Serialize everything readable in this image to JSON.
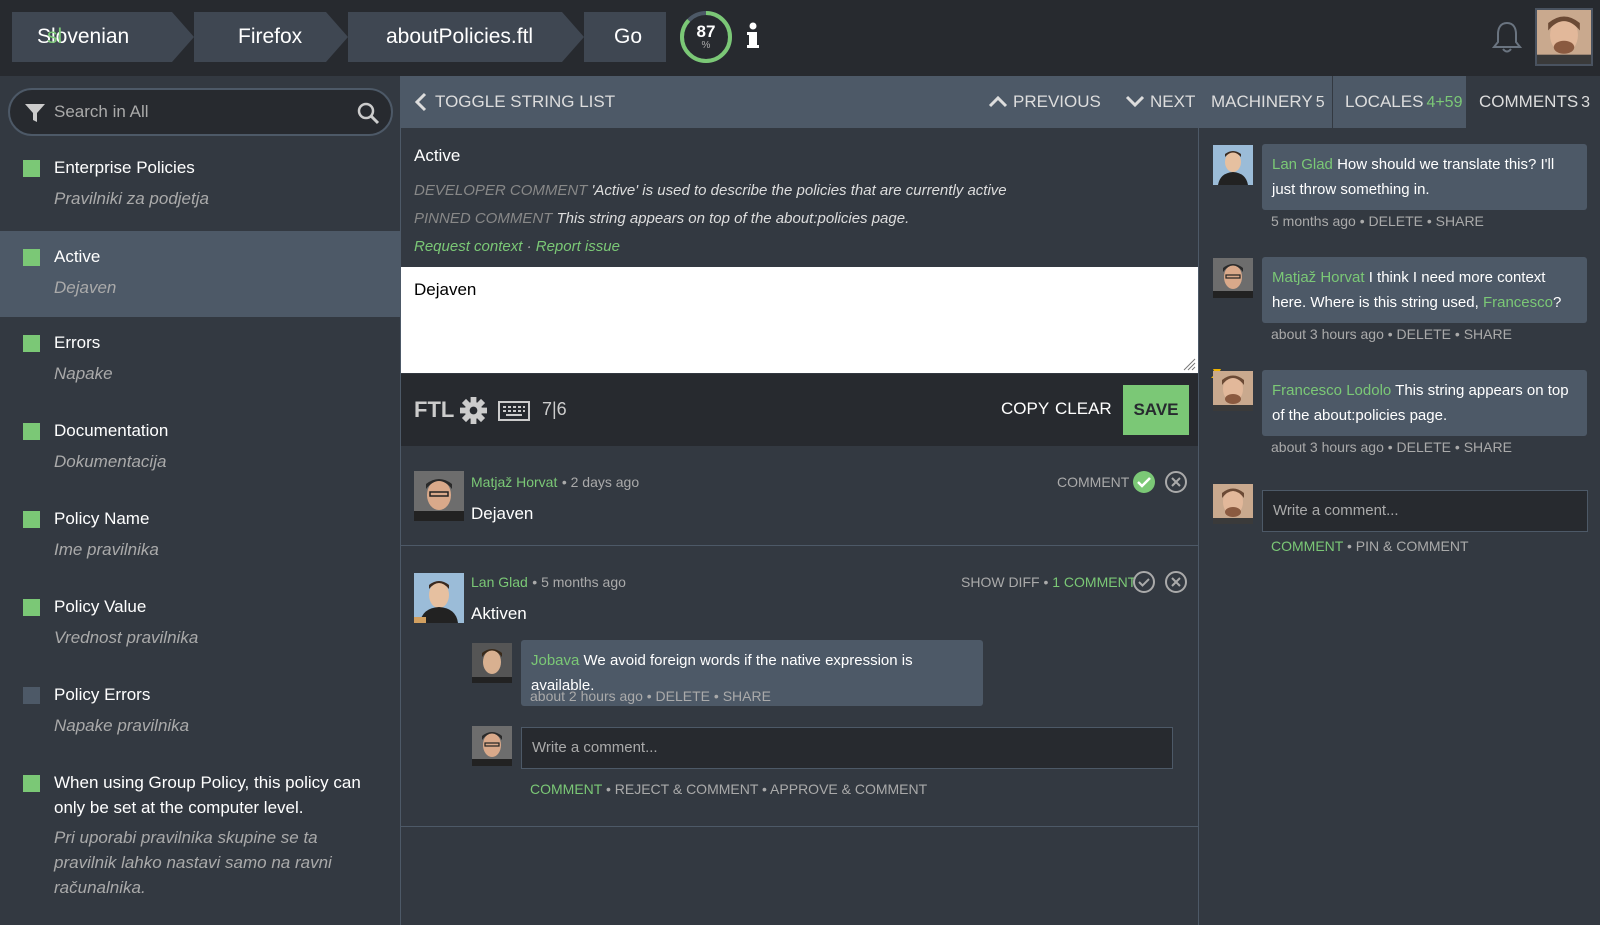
{
  "topbar": {
    "locale": "Slovenian",
    "locale_code": "sl",
    "project": "Firefox",
    "resource": "aboutPolicies.ftl",
    "go_label": "Go",
    "progress_value": "87",
    "progress_unit": "%",
    "progress_fraction": 0.87
  },
  "search": {
    "placeholder": "Search in All"
  },
  "entities": [
    {
      "source": "Enterprise Policies",
      "translation": "Pravilniki za podjetja",
      "status": "translated"
    },
    {
      "source": "Active",
      "translation": "Dejaven",
      "status": "translated"
    },
    {
      "source": "Errors",
      "translation": "Napake",
      "status": "translated"
    },
    {
      "source": "Documentation",
      "translation": "Dokumentacija",
      "status": "translated"
    },
    {
      "source": "Policy Name",
      "translation": "Ime pravilnika",
      "status": "translated"
    },
    {
      "source": "Policy Value",
      "translation": "Vrednost pravilnika",
      "status": "translated"
    },
    {
      "source": "Policy Errors",
      "translation": "Napake pravilnika",
      "status": "missing"
    },
    {
      "source": "When using Group Policy, this policy can only be set at the computer level.",
      "translation": "Pri uporabi pravilnika skupine se ta pravilnik lahko nastavi samo na ravni računalnika.",
      "status": "translated"
    }
  ],
  "editor_header": {
    "toggle": "TOGGLE STRING LIST",
    "previous": "PREVIOUS",
    "next": "NEXT"
  },
  "entity_detail": {
    "original": "Active",
    "dev_comment_label": "DEVELOPER COMMENT",
    "dev_comment": "'Active' is used to describe the policies that are currently active",
    "pinned_label": "PINNED COMMENT",
    "pinned_comment": "This string appears on top of the about:policies page.",
    "request_context": "Request context",
    "separator": "·",
    "report_issue": "Report issue"
  },
  "editor": {
    "value": "Dejaven",
    "ftl": "FTL",
    "char_count": "7|6",
    "copy": "COPY",
    "clear": "CLEAR",
    "save": "SAVE"
  },
  "history": [
    {
      "author": "Matjaž Horvat",
      "date": "• 2 days ago",
      "translation": "Dejaven",
      "action": "COMMENT"
    },
    {
      "author": "Lan Glad",
      "date": "• 5 months ago",
      "translation": "Aktiven",
      "show_diff": "SHOW DIFF",
      "dot": "•",
      "comments": "1 COMMENT",
      "comment": {
        "author": "Jobava",
        "text": "We avoid foreign words if the native expression is available.",
        "meta": "about 2 hours ago • DELETE • SHARE"
      },
      "input_placeholder": "Write a comment...",
      "actions": {
        "comment": "COMMENT",
        "rest": " • REJECT & COMMENT • APPROVE & COMMENT"
      }
    }
  ],
  "tabs": {
    "machinery": "MACHINERY",
    "machinery_count": "5",
    "locales": "LOCALES",
    "locales_count": "4+59",
    "comments": "COMMENTS",
    "comments_count": "3"
  },
  "team_comments": [
    {
      "author": "Lan Glad",
      "text": "How should we translate this? I'll just throw something in.",
      "meta": "5 months ago • DELETE • SHARE"
    },
    {
      "author": "Matjaž Horvat",
      "text_before": "I think I need more context here. Where is this string used, ",
      "mention": "Francesco",
      "text_after": "?",
      "meta": "about 3 hours ago • DELETE • SHARE"
    },
    {
      "author": "Francesco Lodolo",
      "text": "This string appears on top of the about:policies page.",
      "meta": "about 3 hours ago • DELETE • SHARE",
      "pinned": true
    }
  ],
  "team_comment_input": {
    "placeholder": "Write a comment...",
    "comment": "COMMENT",
    "rest": " • PIN & COMMENT"
  },
  "colors": {
    "accent": "#7bc876",
    "dark": "#272a2f",
    "panel": "#333941",
    "mid": "#4d5967"
  },
  "icons": [
    "filter-icon",
    "search-icon",
    "info-icon",
    "bell-icon",
    "chevron-left-icon",
    "chevron-up-icon",
    "chevron-down-icon",
    "gear-icon",
    "keyboard-icon",
    "check-circle-icon",
    "reject-circle-icon",
    "pin-icon"
  ]
}
